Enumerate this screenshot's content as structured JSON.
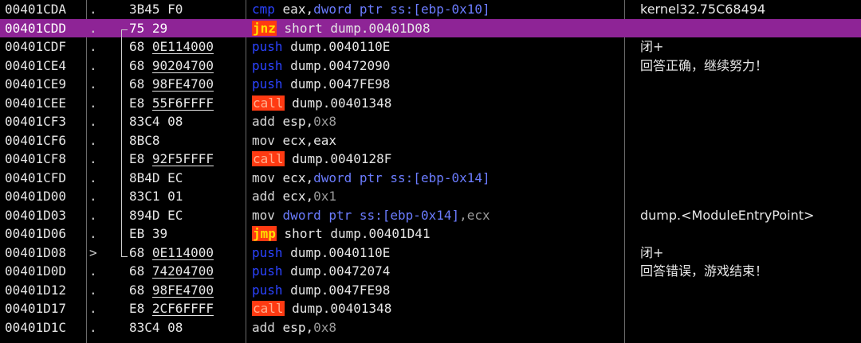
{
  "rows": [
    {
      "addr": "00401CDA",
      "mark": ".",
      "hex": [
        "3B45",
        " F0"
      ],
      "u": [],
      "mn": "cmp",
      "mk": "cmp",
      "ops": [
        [
          "eax,",
          "reg"
        ],
        [
          "dword ptr ss:[ebp-0x10]",
          "mem"
        ]
      ],
      "cmt": "kernel32.75C68494"
    },
    {
      "addr": "00401CDD",
      "mark": ".",
      "hex": [
        "75 29"
      ],
      "u": [],
      "mn": "jnz",
      "mk": "jmp",
      "ops": [
        [
          "short dump.00401D08",
          "reg"
        ]
      ],
      "cmt": "",
      "sel": true
    },
    {
      "addr": "00401CDF",
      "mark": ".",
      "hex": [
        "68 ",
        "0E114000"
      ],
      "u": [
        1
      ],
      "mn": "push",
      "mk": "push",
      "ops": [
        [
          "dump.0040110E",
          "reg"
        ]
      ],
      "cmt": "闭+"
    },
    {
      "addr": "00401CE4",
      "mark": ".",
      "hex": [
        "68 ",
        "90204700"
      ],
      "u": [
        1
      ],
      "mn": "push",
      "mk": "push",
      "ops": [
        [
          "dump.00472090",
          "reg"
        ]
      ],
      "cmt": "回答正确，继续努力！"
    },
    {
      "addr": "00401CE9",
      "mark": ".",
      "hex": [
        "68 ",
        "98FE4700"
      ],
      "u": [
        1
      ],
      "mn": "push",
      "mk": "push",
      "ops": [
        [
          "dump.0047FE98",
          "reg"
        ]
      ],
      "cmt": ""
    },
    {
      "addr": "00401CEE",
      "mark": ".",
      "hex": [
        "E8 ",
        "55F6FFFF"
      ],
      "u": [
        1
      ],
      "mn": "call",
      "mk": "call",
      "ops": [
        [
          "dump.00401348",
          "reg"
        ]
      ],
      "cmt": ""
    },
    {
      "addr": "00401CF3",
      "mark": ".",
      "hex": [
        "83C4 08"
      ],
      "u": [],
      "mn": "add",
      "mk": "plain",
      "ops": [
        [
          "esp,",
          "reg"
        ],
        [
          "0x8",
          "num"
        ]
      ],
      "cmt": ""
    },
    {
      "addr": "00401CF6",
      "mark": ".",
      "hex": [
        "8BC8"
      ],
      "u": [],
      "mn": "mov",
      "mk": "plain",
      "ops": [
        [
          "ecx,eax",
          "reg"
        ]
      ],
      "cmt": ""
    },
    {
      "addr": "00401CF8",
      "mark": ".",
      "hex": [
        "E8 ",
        "92F5FFFF"
      ],
      "u": [
        1
      ],
      "mn": "call",
      "mk": "call",
      "ops": [
        [
          "dump.0040128F",
          "reg"
        ]
      ],
      "cmt": ""
    },
    {
      "addr": "00401CFD",
      "mark": ".",
      "hex": [
        "8B4D EC"
      ],
      "u": [],
      "mn": "mov",
      "mk": "plain",
      "ops": [
        [
          "ecx,",
          "reg"
        ],
        [
          "dword ptr ss:[ebp-0x14]",
          "mem"
        ]
      ],
      "cmt": ""
    },
    {
      "addr": "00401D00",
      "mark": ".",
      "hex": [
        "83C1 01"
      ],
      "u": [],
      "mn": "add",
      "mk": "plain",
      "ops": [
        [
          "ecx,",
          "reg"
        ],
        [
          "0x1",
          "num"
        ]
      ],
      "cmt": ""
    },
    {
      "addr": "00401D03",
      "mark": ".",
      "hex": [
        "894D EC"
      ],
      "u": [],
      "mn": "mov",
      "mk": "plain",
      "ops": [
        [
          "dword ptr ss:[ebp-0x14]",
          "mem"
        ],
        [
          ",ecx",
          "num"
        ]
      ],
      "cmt": "dump.<ModuleEntryPoint>"
    },
    {
      "addr": "00401D06",
      "mark": ".",
      "hex": [
        "EB 39"
      ],
      "u": [],
      "mn": "jmp",
      "mk": "jmp",
      "ops": [
        [
          "short dump.00401D41",
          "reg"
        ]
      ],
      "cmt": ""
    },
    {
      "addr": "00401D08",
      "mark": ">",
      "hex": [
        "68 ",
        "0E114000"
      ],
      "u": [
        1
      ],
      "mn": "push",
      "mk": "push",
      "ops": [
        [
          "dump.0040110E",
          "reg"
        ]
      ],
      "cmt": "闭+"
    },
    {
      "addr": "00401D0D",
      "mark": ".",
      "hex": [
        "68 ",
        "74204700"
      ],
      "u": [
        1
      ],
      "mn": "push",
      "mk": "push",
      "ops": [
        [
          "dump.00472074",
          "reg"
        ]
      ],
      "cmt": "回答错误，游戏结束！"
    },
    {
      "addr": "00401D12",
      "mark": ".",
      "hex": [
        "68 ",
        "98FE4700"
      ],
      "u": [
        1
      ],
      "mn": "push",
      "mk": "push",
      "ops": [
        [
          "dump.0047FE98",
          "reg"
        ]
      ],
      "cmt": ""
    },
    {
      "addr": "00401D17",
      "mark": ".",
      "hex": [
        "E8 ",
        "2CF6FFFF"
      ],
      "u": [
        1
      ],
      "mn": "call",
      "mk": "call",
      "ops": [
        [
          "dump.00401348",
          "reg"
        ]
      ],
      "cmt": ""
    },
    {
      "addr": "00401D1C",
      "mark": ".",
      "hex": [
        "83C4 08"
      ],
      "u": [],
      "mn": "add",
      "mk": "plain",
      "ops": [
        [
          "esp,",
          "reg"
        ],
        [
          "0x8",
          "num"
        ]
      ],
      "cmt": ""
    }
  ],
  "colors": {
    "background": "#000000",
    "selected_row": "#8e2496",
    "push_cmp_mnemonic": "#2b43ff",
    "call_jump_highlight": "#ff3a12",
    "jump_text": "#ffe000",
    "memory_operand": "#6b7cff",
    "number_operand": "#9a9a9a"
  }
}
